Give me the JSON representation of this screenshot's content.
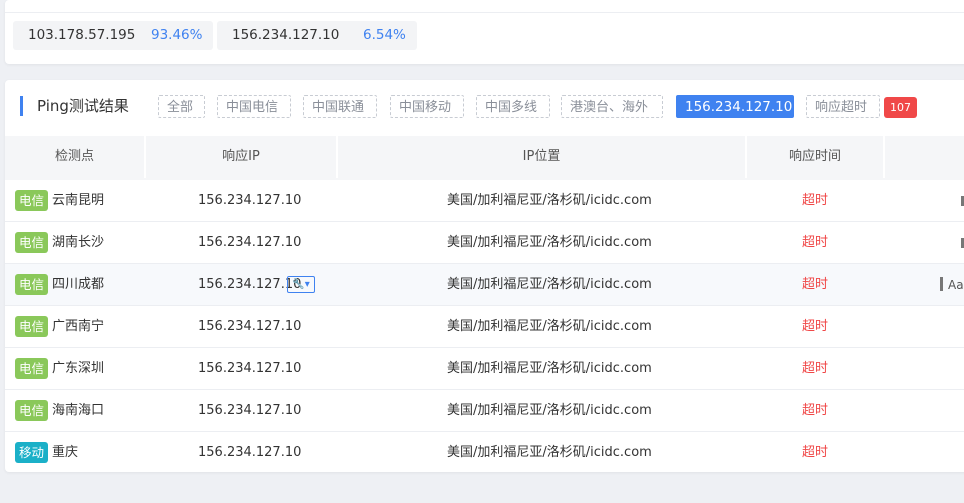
{
  "top_ips": [
    {
      "ip": "103.178.57.195",
      "pct": "93.46%"
    },
    {
      "ip": "156.234.127.10",
      "pct": "6.54%"
    }
  ],
  "panel": {
    "title": "Ping测试结果",
    "filters": [
      "全部",
      "中国电信",
      "中国联通",
      "中国移动",
      "中国多线",
      "港澳台、海外"
    ],
    "active_ip": "156.234.127.10",
    "timeout_label": "响应超时",
    "timeout_count": "107"
  },
  "table": {
    "headers": [
      "检测点",
      "响应IP",
      "IP位置",
      "响应时间"
    ],
    "rows": [
      {
        "isp": "电信",
        "isp_type": "telecom",
        "location": "云南昆明",
        "ip": "156.234.127.10",
        "geo": "美国/加利福尼亚/洛杉矶/icidc.com",
        "time": "超时"
      },
      {
        "isp": "电信",
        "isp_type": "telecom",
        "location": "湖南长沙",
        "ip": "156.234.127.10",
        "geo": "美国/加利福尼亚/洛杉矶/icidc.com",
        "time": "超时"
      },
      {
        "isp": "电信",
        "isp_type": "telecom",
        "location": "四川成都",
        "ip": "156.234.127.10",
        "geo": "美国/加利福尼亚/洛杉矶/icidc.com",
        "time": "超时",
        "extra": "Aal"
      },
      {
        "isp": "电信",
        "isp_type": "telecom",
        "location": "广西南宁",
        "ip": "156.234.127.10",
        "geo": "美国/加利福尼亚/洛杉矶/icidc.com",
        "time": "超时"
      },
      {
        "isp": "电信",
        "isp_type": "telecom",
        "location": "广东深圳",
        "ip": "156.234.127.10",
        "geo": "美国/加利福尼亚/洛杉矶/icidc.com",
        "time": "超时"
      },
      {
        "isp": "电信",
        "isp_type": "telecom",
        "location": "海南海口",
        "ip": "156.234.127.10",
        "geo": "美国/加利福尼亚/洛杉矶/icidc.com",
        "time": "超时"
      },
      {
        "isp": "移动",
        "isp_type": "mobile",
        "location": "重庆",
        "ip": "156.234.127.10",
        "geo": "美国/加利福尼亚/洛杉矶/icidc.com",
        "time": "超时"
      }
    ]
  },
  "colors": {
    "accent": "#3f82f0",
    "telecom": "#8ac85a",
    "mobile": "#1bb0c8",
    "timeout": "#f04848"
  },
  "icons": {
    "tool": "wrench-dropdown-icon"
  }
}
